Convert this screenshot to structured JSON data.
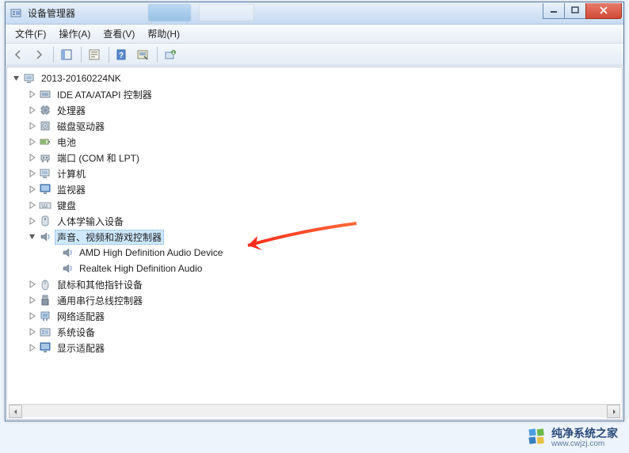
{
  "window": {
    "title": "设备管理器"
  },
  "menu": {
    "file": "文件(F)",
    "action": "操作(A)",
    "view": "查看(V)",
    "help": "帮助(H)"
  },
  "tree": {
    "root": "2013-20160224NK",
    "items": [
      {
        "label": "IDE ATA/ATAPI 控制器",
        "icon": "ide"
      },
      {
        "label": "处理器",
        "icon": "cpu"
      },
      {
        "label": "磁盘驱动器",
        "icon": "disk"
      },
      {
        "label": "电池",
        "icon": "battery"
      },
      {
        "label": "端口 (COM 和 LPT)",
        "icon": "port"
      },
      {
        "label": "计算机",
        "icon": "computer"
      },
      {
        "label": "监视器",
        "icon": "monitor"
      },
      {
        "label": "键盘",
        "icon": "keyboard"
      },
      {
        "label": "人体学输入设备",
        "icon": "hid"
      }
    ],
    "sound": {
      "label": "声音、视频和游戏控制器",
      "children": [
        "AMD High Definition Audio Device",
        "Realtek High Definition Audio"
      ]
    },
    "items2": [
      {
        "label": "鼠标和其他指针设备",
        "icon": "mouse"
      },
      {
        "label": "通用串行总线控制器",
        "icon": "usb"
      },
      {
        "label": "网络适配器",
        "icon": "network"
      },
      {
        "label": "系统设备",
        "icon": "system"
      },
      {
        "label": "显示适配器",
        "icon": "display"
      }
    ]
  },
  "watermark": {
    "title": "纯净系统之家",
    "url": "www.cwjzj.com"
  }
}
